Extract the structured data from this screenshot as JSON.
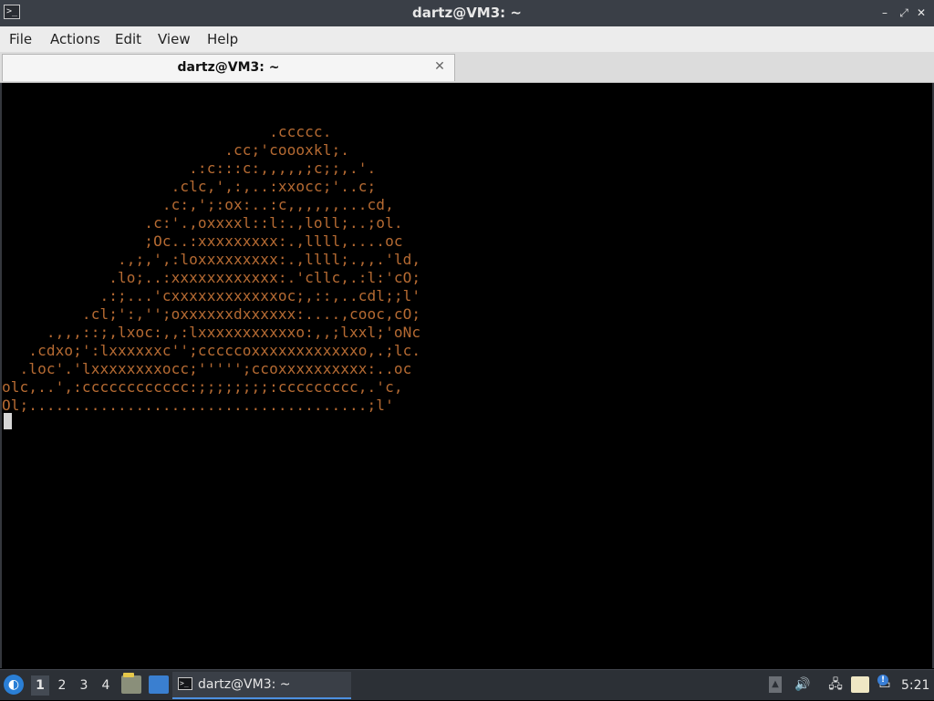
{
  "window": {
    "title": "dartz@VM3: ~",
    "app_icon": ">_",
    "buttons": {
      "minimize": "–",
      "maximize": "⤢",
      "close": "✕"
    }
  },
  "menu": {
    "file": "File",
    "actions": "Actions",
    "edit": "Edit",
    "view": "View",
    "help": "Help"
  },
  "tab": {
    "label": "dartz@VM3: ~",
    "close": "✕"
  },
  "terminal": {
    "output": "                              .ccccc.\n                         .cc;'coooxkl;.\n                     .:c:::c:,,,,,;c;;,.'.\n                   .clc,',:,..:xxocc;'..c;\n                  .c:,';:ox:..:c,,,,,,...cd,\n                .c:'.,oxxxxl::l:.,loll;..;ol.\n                ;Oc..:xxxxxxxxx:.,llll,....oc\n             .,;,',:loxxxxxxxxx:.,llll;.,,.'ld,\n            .lo;..:xxxxxxxxxxxx:.'cllc,.:l:'cO;\n           .:;...'cxxxxxxxxxxxxoc;,::,..cdl;;l'\n         .cl;':,'';oxxxxxxdxxxxxx:....,cooc,cO;\n     .,,,::;,lxoc:,,:lxxxxxxxxxxxo:,,;lxxl;'oNc\n   .cdxo;':lxxxxxxc'';cccccoxxxxxxxxxxxxo,.;lc.\n  .loc'.'lxxxxxxxxocc;''''';ccoxxxxxxxxxx:..oc\nolc,..',:cccccccccccc:;;;;;;;;:ccccccccc,.'c,\nOl;......................................;l'"
  },
  "taskbar": {
    "start_icon": "start-menu-icon",
    "workspaces": [
      "1",
      "2",
      "3",
      "4"
    ],
    "active_workspace": "1",
    "task_label": "dartz@VM3: ~",
    "clock": "5:21",
    "update_badge": "!"
  },
  "colors": {
    "terminal_bg": "#000000",
    "terminal_fg": "#b56a32",
    "titlebar": "#3a3f47",
    "taskbar": "#2c3036",
    "accent": "#2a7fd6"
  }
}
